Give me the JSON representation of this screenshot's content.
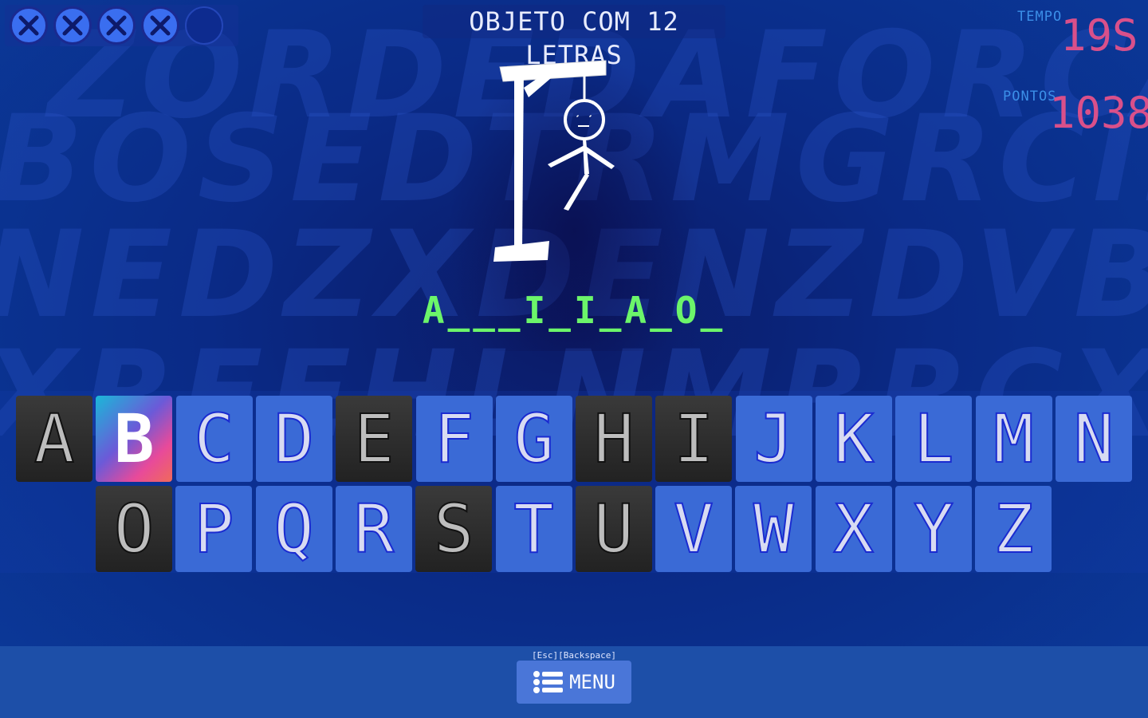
{
  "background_words": [
    "ZORDEDAFORCAJLDX",
    "BOSEDTRMGRCIRSSV",
    "NEDZXDENZDVBHYF",
    "XRFEHLNMRRCXOTY"
  ],
  "lives": {
    "lost": 4,
    "total": 5
  },
  "category": "OBJETO COM 12 LETRAS",
  "time": {
    "label": "TEMPO",
    "value": "19S"
  },
  "score": {
    "label": "PONTOS",
    "value": "1038"
  },
  "word_mask": "A___I_I_A_O_",
  "keyboard": {
    "row1": [
      {
        "letter": "A",
        "state": "used"
      },
      {
        "letter": "B",
        "state": "selected"
      },
      {
        "letter": "C",
        "state": "available"
      },
      {
        "letter": "D",
        "state": "available"
      },
      {
        "letter": "E",
        "state": "used"
      },
      {
        "letter": "F",
        "state": "available"
      },
      {
        "letter": "G",
        "state": "available"
      },
      {
        "letter": "H",
        "state": "used"
      },
      {
        "letter": "I",
        "state": "used"
      },
      {
        "letter": "J",
        "state": "available"
      },
      {
        "letter": "K",
        "state": "available"
      },
      {
        "letter": "L",
        "state": "available"
      },
      {
        "letter": "M",
        "state": "available"
      },
      {
        "letter": "N",
        "state": "available"
      }
    ],
    "row2": [
      {
        "letter": "O",
        "state": "used"
      },
      {
        "letter": "P",
        "state": "available"
      },
      {
        "letter": "Q",
        "state": "available"
      },
      {
        "letter": "R",
        "state": "available"
      },
      {
        "letter": "S",
        "state": "used"
      },
      {
        "letter": "T",
        "state": "available"
      },
      {
        "letter": "U",
        "state": "used"
      },
      {
        "letter": "V",
        "state": "available"
      },
      {
        "letter": "W",
        "state": "available"
      },
      {
        "letter": "X",
        "state": "available"
      },
      {
        "letter": "Y",
        "state": "available"
      },
      {
        "letter": "Z",
        "state": "available"
      }
    ]
  },
  "footer": {
    "shortcut_hint": "[Esc][Backspace]",
    "menu_label": "MENU",
    "menu_icon": "list-icon"
  },
  "colors": {
    "revealed": "#6cf56a",
    "stat_value": "#d9508a",
    "stat_label": "#3b8fe8"
  }
}
